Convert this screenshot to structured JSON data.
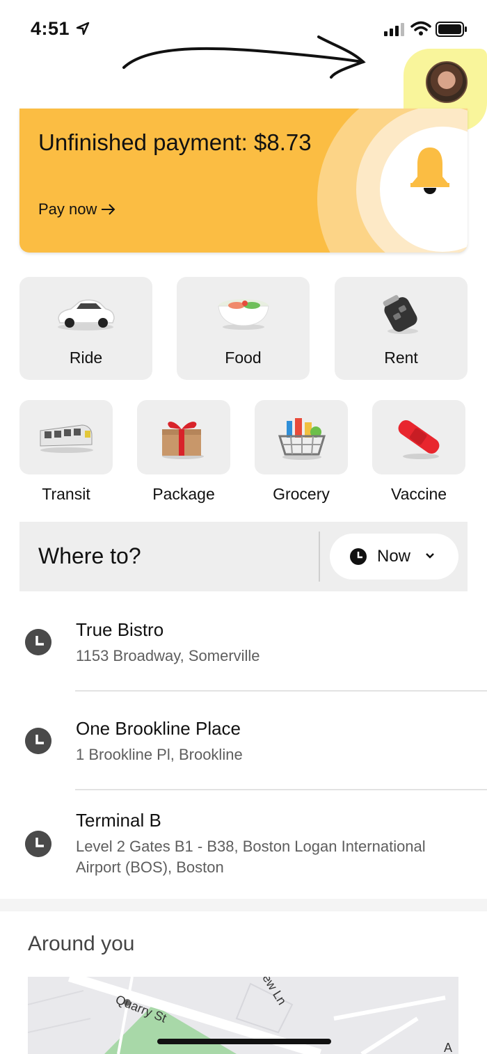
{
  "status_bar": {
    "time": "4:51"
  },
  "promo": {
    "title": "Unfinished payment: $8.73",
    "link_label": "Pay now"
  },
  "services_large": [
    {
      "label": "Ride",
      "icon": "car-icon"
    },
    {
      "label": "Food",
      "icon": "food-bowl-icon"
    },
    {
      "label": "Rent",
      "icon": "car-key-icon"
    }
  ],
  "services_small": [
    {
      "label": "Transit",
      "icon": "train-icon"
    },
    {
      "label": "Package",
      "icon": "gift-box-icon"
    },
    {
      "label": "Grocery",
      "icon": "grocery-basket-icon"
    },
    {
      "label": "Vaccine",
      "icon": "bandage-icon"
    }
  ],
  "search": {
    "placeholder": "Where to?",
    "time_option": "Now"
  },
  "recent_places": [
    {
      "name": "True Bistro",
      "address": "1153 Broadway, Somerville"
    },
    {
      "name": "One Brookline Place",
      "address": "1 Brookline Pl, Brookline"
    },
    {
      "name": "Terminal B",
      "address": "Level 2 Gates B1 - B38, Boston Logan International Airport (BOS), Boston"
    }
  ],
  "around_you": {
    "title": "Around you",
    "map_labels": [
      "Quarry St",
      "ew Ln",
      "A"
    ]
  },
  "colors": {
    "promo_bg": "#fbbd43",
    "tile_bg": "#eeeeee",
    "highlight": "#f7f27a"
  }
}
